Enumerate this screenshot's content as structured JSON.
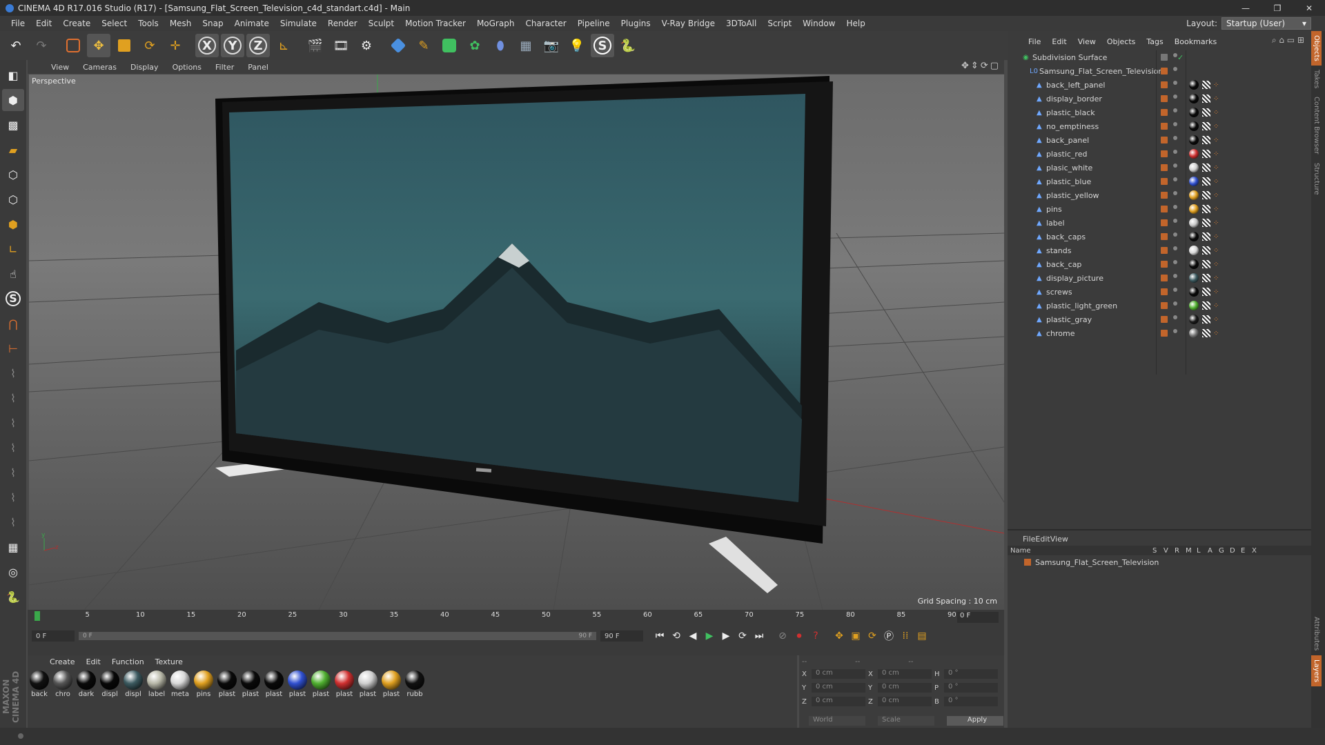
{
  "window": {
    "title": "CINEMA 4D R17.016 Studio (R17) - [Samsung_Flat_Screen_Television_c4d_standart.c4d] - Main"
  },
  "menu": [
    "File",
    "Edit",
    "Create",
    "Select",
    "Tools",
    "Mesh",
    "Snap",
    "Animate",
    "Simulate",
    "Render",
    "Sculpt",
    "Motion Tracker",
    "MoGraph",
    "Character",
    "Pipeline",
    "Plugins",
    "V-Ray Bridge",
    "3DToAll",
    "Script",
    "Window",
    "Help"
  ],
  "layout": {
    "label": "Layout:",
    "value": "Startup (User)"
  },
  "viewport": {
    "menu": [
      "View",
      "Cameras",
      "Display",
      "Options",
      "Filter",
      "Panel"
    ],
    "camera_label": "Perspective",
    "grid_spacing": "Grid Spacing : 10 cm"
  },
  "objects_panel": {
    "menu": [
      "File",
      "Edit",
      "View",
      "Objects",
      "Tags",
      "Bookmarks"
    ],
    "root": "Subdivision Surface",
    "group": "Samsung_Flat_Screen_Television",
    "children": [
      {
        "name": "back_left_panel",
        "mat": "#0a0a0a"
      },
      {
        "name": "display_border",
        "mat": "#0a0a0a"
      },
      {
        "name": "plastic_black",
        "mat": "#0a0a0a"
      },
      {
        "name": "no_emptiness",
        "mat": "#0a0a0a"
      },
      {
        "name": "back_panel",
        "mat": "#0a0a0a"
      },
      {
        "name": "plastic_red",
        "mat": "#d03030"
      },
      {
        "name": "plasic_white",
        "mat": "#d0d0d0"
      },
      {
        "name": "plastic_blue",
        "mat": "#3050d0"
      },
      {
        "name": "plastic_yellow",
        "mat": "#e0a020"
      },
      {
        "name": "pins",
        "mat": "#e0a020"
      },
      {
        "name": "label",
        "mat": "#c8c8c8"
      },
      {
        "name": "back_caps",
        "mat": "#0a0a0a"
      },
      {
        "name": "stands",
        "mat": "#d8d8d8"
      },
      {
        "name": "back_cap",
        "mat": "#0a0a0a"
      },
      {
        "name": "display_picture",
        "mat": "#3c5a60"
      },
      {
        "name": "screws",
        "mat": "#0a0a0a"
      },
      {
        "name": "plastic_light_green",
        "mat": "#50b030"
      },
      {
        "name": "plastic_gray",
        "mat": "#1a1a1a"
      },
      {
        "name": "chrome",
        "mat": "#777777"
      }
    ]
  },
  "attributes_panel": {
    "menu": [
      "File",
      "Edit",
      "View"
    ],
    "columns": [
      "Name",
      "S",
      "V",
      "R",
      "M",
      "L",
      "A",
      "G",
      "D",
      "E",
      "X"
    ],
    "row": "Samsung_Flat_Screen_Television"
  },
  "side_tabs": [
    "Objects",
    "Takes",
    "Content Browser",
    "Structure",
    "Attributes",
    "Layers"
  ],
  "timeline": {
    "ticks": [
      "0",
      "5",
      "10",
      "15",
      "20",
      "25",
      "30",
      "35",
      "40",
      "45",
      "50",
      "55",
      "60",
      "65",
      "70",
      "75",
      "80",
      "85",
      "90"
    ],
    "frame_display": "0 F",
    "start_field": "0 F",
    "slider_start": "0 F",
    "slider_end": "90 F",
    "end_field": "90 F"
  },
  "materials": {
    "menu": [
      "Create",
      "Edit",
      "Function",
      "Texture"
    ],
    "items": [
      {
        "label": "back",
        "color": "#111111"
      },
      {
        "label": "chro",
        "color": "#555555"
      },
      {
        "label": "dark",
        "color": "#0a0a0a"
      },
      {
        "label": "displ",
        "color": "#080808"
      },
      {
        "label": "displ",
        "color": "#3c5a60"
      },
      {
        "label": "label",
        "color": "#b8b8a8"
      },
      {
        "label": "meta",
        "color": "#d8d8d8"
      },
      {
        "label": "pins",
        "color": "#e0a020"
      },
      {
        "label": "plast",
        "color": "#0a0a0a"
      },
      {
        "label": "plast",
        "color": "#0a0a0a"
      },
      {
        "label": "plast",
        "color": "#0a0a0a"
      },
      {
        "label": "plast",
        "color": "#3050d0"
      },
      {
        "label": "plast",
        "color": "#50b030"
      },
      {
        "label": "plast",
        "color": "#d03030"
      },
      {
        "label": "plast",
        "color": "#d0d0d0"
      },
      {
        "label": "plast",
        "color": "#e0a020"
      },
      {
        "label": "rubb",
        "color": "#111111"
      }
    ]
  },
  "coordinates": {
    "rows": [
      {
        "a": "X",
        "av": "0 cm",
        "b": "X",
        "bv": "0 cm",
        "c": "H",
        "cv": "0 °"
      },
      {
        "a": "Y",
        "av": "0 cm",
        "b": "Y",
        "bv": "0 cm",
        "c": "P",
        "cv": "0 °"
      },
      {
        "a": "Z",
        "av": "0 cm",
        "b": "Z",
        "bv": "0 cm",
        "c": "B",
        "cv": "0 °"
      }
    ],
    "world": "World",
    "scale": "Scale",
    "apply": "Apply"
  },
  "colors": {
    "accent": "#c2652b",
    "blue": "#6fa8ff"
  }
}
